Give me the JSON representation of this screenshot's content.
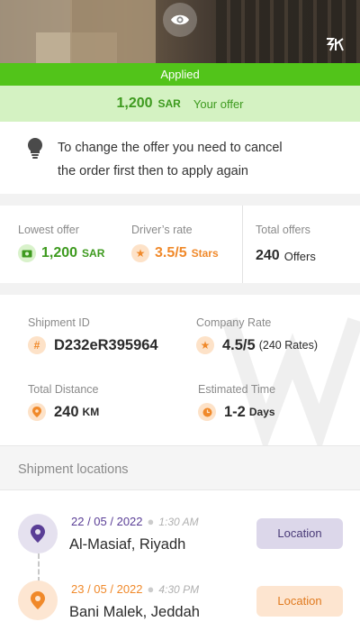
{
  "header": {
    "status_banner": "Applied",
    "offer": {
      "amount": "1,200",
      "currency": "SAR",
      "label": "Your offer"
    },
    "colors": {
      "applied": "#52c41a",
      "offer_bg": "#d4f2c2"
    }
  },
  "notice": {
    "icon": "lightbulb-icon",
    "line1": "To change the offer you need to cancel",
    "line2": "the order first then to apply again"
  },
  "stats": {
    "lowest_offer": {
      "label": "Lowest offer",
      "value": "1,200",
      "unit": "SAR",
      "icon": "money-icon"
    },
    "drivers_rate": {
      "label": "Driver’s rate",
      "value": "3.5/5",
      "unit": "Stars",
      "icon": "star-icon"
    },
    "total_offers": {
      "label": "Total offers",
      "value": "240",
      "unit": "Offers"
    }
  },
  "shipment": {
    "id": {
      "label": "Shipment ID",
      "value": "D232eR395964",
      "icon": "hash-icon"
    },
    "company_rate": {
      "label": "Company Rate",
      "value": "4.5/5",
      "extra": "(240 Rates)",
      "icon": "star-icon"
    },
    "distance": {
      "label": "Total Distance",
      "value": "240",
      "unit": "KM",
      "icon": "location-pin-icon"
    },
    "time": {
      "label": "Estimated Time",
      "value": "1-2",
      "unit": "Days",
      "icon": "clock-icon"
    }
  },
  "locations": {
    "title": "Shipment locations",
    "items": [
      {
        "date": "22 / 05 / 2022",
        "time": "1:30 AM",
        "city": "Al-Masiaf, Riyadh",
        "button": "Location",
        "color": "#5a3e96"
      },
      {
        "date": "23 / 05 / 2022",
        "time": "4:30 PM",
        "city": "Bani Malek, Jeddah",
        "button": "Location",
        "color": "#f0892a"
      }
    ]
  }
}
